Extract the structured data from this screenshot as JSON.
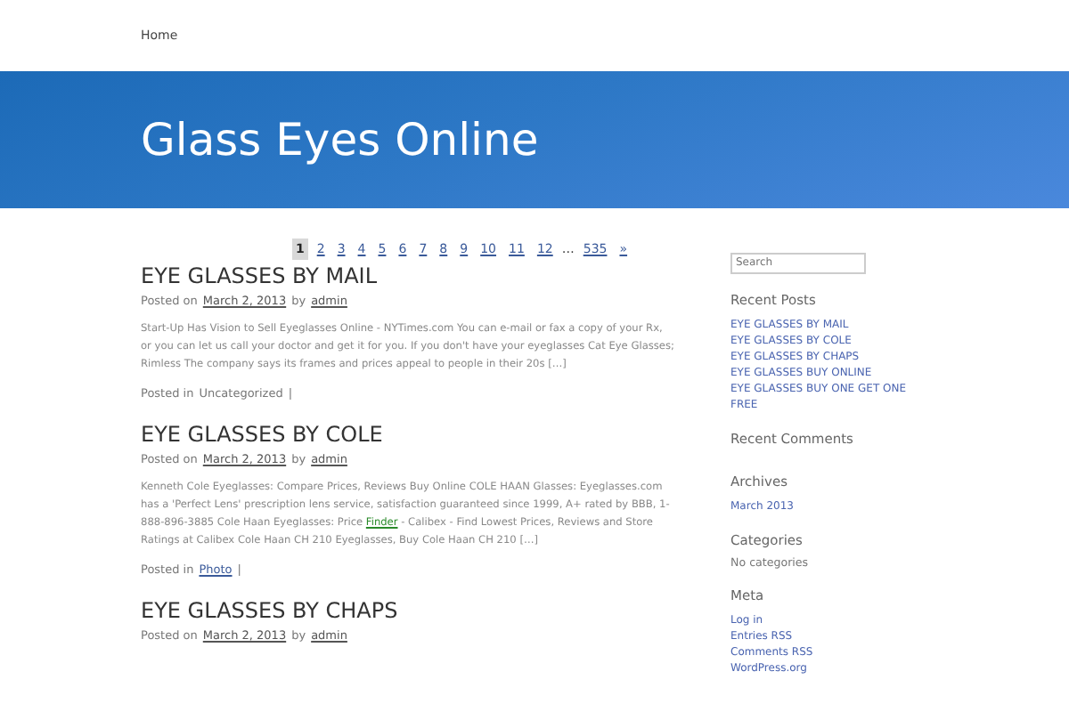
{
  "nav": {
    "items": [
      "Home"
    ]
  },
  "header": {
    "title": "Glass Eyes Online"
  },
  "pagination": [
    {
      "label": "1",
      "selected": true
    },
    {
      "label": "2",
      "selected": false
    },
    {
      "label": "3",
      "selected": false
    },
    {
      "label": "4",
      "selected": false
    },
    {
      "label": "5",
      "selected": false
    },
    {
      "label": "6",
      "selected": false
    },
    {
      "label": "7",
      "selected": false
    },
    {
      "label": "8",
      "selected": false
    },
    {
      "label": "9",
      "selected": false
    },
    {
      "label": "10",
      "selected": false
    },
    {
      "label": "11",
      "selected": false
    },
    {
      "label": "12",
      "selected": false
    },
    {
      "label": "…",
      "kind": "gap"
    },
    {
      "label": "535",
      "selected": false
    },
    {
      "label": "»",
      "selected": false
    }
  ],
  "posts": [
    {
      "title": "EYE GLASSES BY MAIL",
      "posted_on": "Posted on",
      "date": "March 2, 2013",
      "by": "by",
      "author": "admin",
      "excerpt": [
        {
          "kind": "text",
          "text": "Start-Up Has Vision to Sell Eyeglasses Online - NYTimes.com You can e-mail or fax a copy of your Rx, or you can let us call your doctor and get it for you. If you don't have your eyeglasses Cat Eye Glasses; Rimless The company says its frames and prices appeal to people in their 20s […]"
        }
      ],
      "posted_in": "Posted in",
      "category": "Uncategorized",
      "category_linked": false,
      "separator": "|"
    },
    {
      "title": "EYE GLASSES BY COLE",
      "posted_on": "Posted on",
      "date": "March 2, 2013",
      "by": "by",
      "author": "admin",
      "excerpt": [
        {
          "kind": "text",
          "text": "Kenneth Cole Eyeglasses: Compare Prices, Reviews Buy Online COLE HAAN Glasses: Eyeglasses.com has a 'Perfect Lens' prescription lens service, satisfaction guaranteed since 1999, A+ rated by BBB, 1-888-896-3885 Cole Haan Eyeglasses: Price "
        },
        {
          "kind": "link",
          "text": "Finder"
        },
        {
          "kind": "text",
          "text": " - Calibex - Find Lowest Prices, Reviews and Store Ratings at Calibex Cole Haan CH 210 Eyeglasses, Buy Cole Haan CH 210 […]"
        }
      ],
      "posted_in": "Posted in",
      "category": "Photo",
      "category_linked": true,
      "separator": "|"
    },
    {
      "title": "EYE GLASSES BY CHAPS",
      "posted_on": "Posted on",
      "date": "March 2, 2013",
      "by": "by",
      "author": "admin"
    }
  ],
  "sidebar": {
    "search": {
      "placeholder": "Search"
    },
    "widgets": [
      {
        "title": "Recent Posts",
        "kind": "links",
        "items": [
          "EYE GLASSES BY MAIL",
          "EYE GLASSES BY COLE",
          "EYE GLASSES BY CHAPS",
          "EYE GLASSES BUY ONLINE",
          "EYE GLASSES BUY ONE GET ONE FREE"
        ]
      },
      {
        "title": "Recent Comments"
      },
      {
        "title": "Archives",
        "kind": "links",
        "items": [
          "March 2013"
        ]
      },
      {
        "title": "Categories",
        "kind": "text",
        "items": [
          "No categories"
        ]
      },
      {
        "title": "Meta",
        "kind": "links",
        "items": [
          "Log in",
          "Entries RSS",
          "Comments RSS",
          "WordPress.org"
        ]
      }
    ]
  }
}
